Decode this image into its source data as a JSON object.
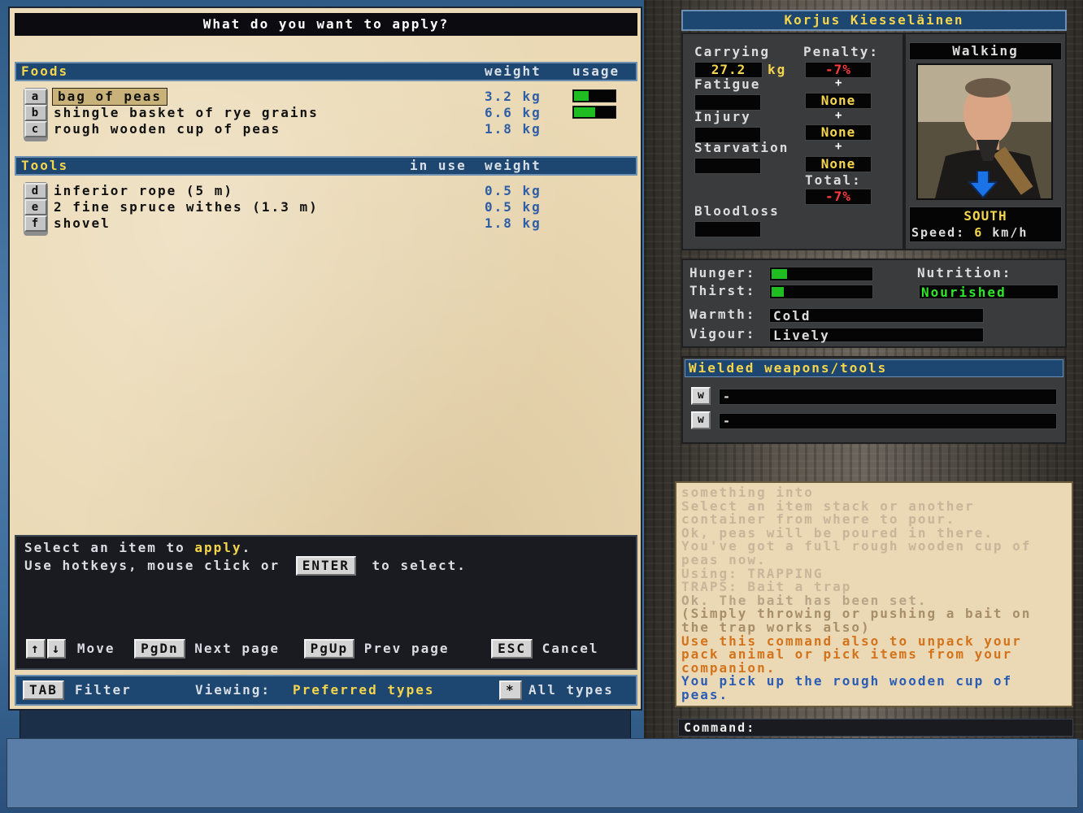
{
  "dialog": {
    "title": "What do you want to apply?",
    "foods": {
      "header": "Foods",
      "col_weight": "weight",
      "col_usage": "usage",
      "items": [
        {
          "key": "a",
          "name": "bag of peas",
          "weight": "3.2 kg",
          "usage": 0.35
        },
        {
          "key": "b",
          "name": "shingle basket of rye grains",
          "weight": "6.6 kg",
          "usage": 0.5
        },
        {
          "key": "c",
          "name": "rough wooden cup of peas",
          "weight": "1.8 kg"
        }
      ]
    },
    "tools": {
      "header": "Tools",
      "col_in_use": "in use",
      "col_weight": "weight",
      "items": [
        {
          "key": "d",
          "name": "inferior rope (5 m)",
          "weight": "0.5 kg"
        },
        {
          "key": "e",
          "name": "2 fine spruce withes (1.3 m)",
          "weight": "0.5 kg"
        },
        {
          "key": "f",
          "name": "shovel",
          "weight": "1.8 kg"
        }
      ]
    },
    "hint": {
      "line1_prefix": "Select an item to ",
      "line1_action": "apply",
      "line1_suffix": ".",
      "line2_prefix": "Use hotkeys, mouse click or",
      "line2_key": "ENTER",
      "line2_suffix": "to select.",
      "up_key": "↑",
      "down_key": "↓",
      "move_label": "Move",
      "pgdn_key": "PgDn",
      "pgdn_label": "Next page",
      "pgup_key": "PgUp",
      "pgup_label": "Prev page",
      "esc_key": "ESC",
      "esc_label": "Cancel"
    },
    "filter": {
      "tab_key": "TAB",
      "tab_label": "Filter",
      "viewing_label": "Viewing:",
      "viewing_value": "Preferred types",
      "all_key": "*",
      "all_label": "All types"
    }
  },
  "character": {
    "name": "Korjus Kiesseläinen",
    "carrying_label": "Carrying",
    "carrying_value": "27.2",
    "carrying_unit": "kg",
    "penalty_label": "Penalty:",
    "penalty_value": "-7%",
    "fatigue_label": "Fatigue",
    "fatigue_penalty": "None",
    "injury_label": "Injury",
    "injury_penalty": "None",
    "starvation_label": "Starvation",
    "starvation_penalty": "None",
    "total_label": "Total:",
    "total_value": "-7%",
    "bloodloss_label": "Bloodloss",
    "plus": "+",
    "movement_mode": "Walking",
    "direction": "SOUTH",
    "speed_label": "Speed:",
    "speed_value": "6",
    "speed_unit": "km/h"
  },
  "status": {
    "hunger_label": "Hunger:",
    "hunger_level": 0.15,
    "thirst_label": "Thirst:",
    "thirst_level": 0.12,
    "nutrition_label": "Nutrition:",
    "nutrition_value": "Nourished",
    "warmth_label": "Warmth:",
    "warmth_value": "Cold",
    "vigour_label": "Vigour:",
    "vigour_value": "Lively"
  },
  "wielded": {
    "header": "Wielded weapons/tools",
    "slots": [
      {
        "key": "w",
        "value": "-"
      },
      {
        "key": "w",
        "value": "-"
      }
    ]
  },
  "messages": [
    {
      "text": "something into",
      "color": "#c8b59a"
    },
    {
      "text": "Select an item stack or another container from where to pour.",
      "color": "#c8b59a"
    },
    {
      "text": "Ok, peas will be poured in there.",
      "color": "#c8b59a"
    },
    {
      "text": "You've got a full rough wooden cup of peas now.",
      "color": "#c8b59a"
    },
    {
      "text": "Using: TRAPPING",
      "color": "#c8b59a"
    },
    {
      "text": "TRAPS: Bait a trap",
      "color": "#c8b59a"
    },
    {
      "text": "Ok. The bait has been set.",
      "color": "#b9a488"
    },
    {
      "text": "(Simply throwing or pushing a bait on the trap works also)",
      "color": "#a88e6a"
    },
    {
      "text": "Use this command also to unpack your pack animal or pick items from your companion.",
      "color": "#d4731c"
    },
    {
      "text": "You pick up the rough wooden cup of peas.",
      "color": "#2b5db5"
    }
  ],
  "command": {
    "label": "Command:",
    "value": ""
  },
  "colors": {
    "accent_yellow": "#f4d54b",
    "header_blue": "#1d4670",
    "weight_blue": "#2e5ea6",
    "penalty_red": "#ff3b3b",
    "bar_green": "#1fbd22"
  }
}
